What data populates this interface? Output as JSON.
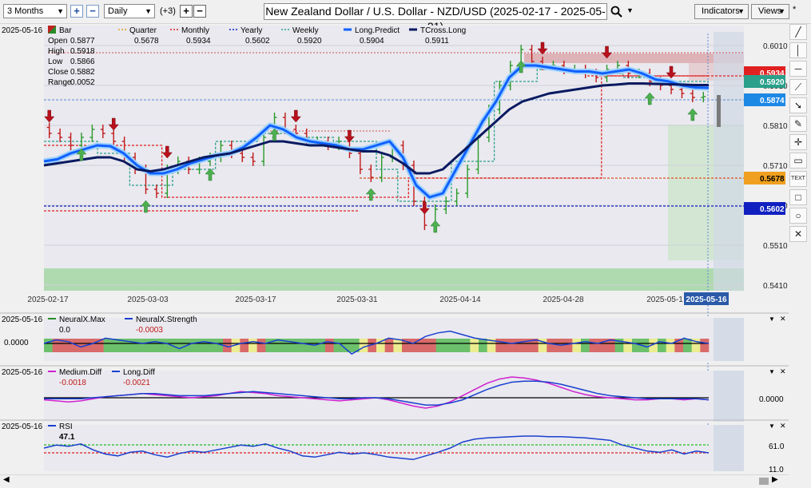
{
  "toolbar": {
    "period": "3 Months",
    "interval": "Daily",
    "extra": "(+3)",
    "title": "New Zealand Dollar / U.S. Dollar - NZD/USD (2025-02-17 - 2025-05-21)",
    "indicators_label": "Indicators",
    "views_label": "Views",
    "pin": "*"
  },
  "main_panel": {
    "date": "2025-05-16",
    "ohlc": [
      {
        "label": "Open",
        "value": "0.5877"
      },
      {
        "label": "High",
        "value": "0.5918"
      },
      {
        "label": "Low",
        "value": "0.5866"
      },
      {
        "label": "Close",
        "value": "0.5882"
      },
      {
        "label": "Range",
        "value": "0.0052"
      }
    ],
    "legend": [
      {
        "name": "Bar",
        "value": "",
        "color": "#2a8a2a"
      },
      {
        "name": "Quarter",
        "value": "0.5678",
        "color": "#e2a51e"
      },
      {
        "name": "Monthly",
        "value": "0.5934",
        "color": "#e02020"
      },
      {
        "name": "Yearly",
        "value": "0.5602",
        "color": "#1020c0"
      },
      {
        "name": "Weekly",
        "value": "0.5920",
        "color": "#2aa08a"
      },
      {
        "name": "Long.Predict",
        "value": "0.5904",
        "color": "#1060ff"
      },
      {
        "name": "TCross.Long",
        "value": "0.5911",
        "color": "#0a1a60"
      }
    ],
    "price_ticks": [
      "0.6010",
      "0.5910",
      "0.5810",
      "0.5710",
      "0.5610",
      "0.5510",
      "0.5410"
    ],
    "price_tags": [
      {
        "label": "0.5934",
        "color": "#e02020"
      },
      {
        "label": "0.5920",
        "color": "#2aa08a"
      },
      {
        "label": "0.5874",
        "color": "#1e88e5"
      },
      {
        "label": "0.5678",
        "color": "#f0a020"
      },
      {
        "label": "0.5602",
        "color": "#1020c0"
      }
    ],
    "date_ticks": [
      "2025-02-17",
      "2025-03-03",
      "2025-03-17",
      "2025-03-31",
      "2025-04-14",
      "2025-04-28",
      "2025-05-1",
      "2025-05-16"
    ]
  },
  "chart_data": {
    "type": "candlestick",
    "series": [
      {
        "name": "Long.Predict",
        "values": [
          0.572,
          0.5725,
          0.574,
          0.575,
          0.576,
          0.5758,
          0.574,
          0.571,
          0.569,
          0.569,
          0.57,
          0.5715,
          0.5725,
          0.5735,
          0.574,
          0.5755,
          0.578,
          0.581,
          0.58,
          0.578,
          0.577,
          0.5765,
          0.576,
          0.575,
          0.575,
          0.576,
          0.577,
          0.573,
          0.566,
          0.563,
          0.564,
          0.57,
          0.576,
          0.582,
          0.587,
          0.593,
          0.596,
          0.596,
          0.5955,
          0.595,
          0.5945,
          0.5945,
          0.594,
          0.5945,
          0.595,
          0.594,
          0.5925,
          0.592,
          0.591,
          0.5905,
          0.5904
        ]
      },
      {
        "name": "TCross.Long",
        "values": [
          0.571,
          0.5715,
          0.572,
          0.5725,
          0.573,
          0.573,
          0.572,
          0.57,
          0.5695,
          0.57,
          0.571,
          0.572,
          0.573,
          0.5735,
          0.574,
          0.575,
          0.576,
          0.577,
          0.577,
          0.5765,
          0.576,
          0.576,
          0.5755,
          0.575,
          0.5745,
          0.5745,
          0.5735,
          0.5715,
          0.569,
          0.569,
          0.57,
          0.573,
          0.576,
          0.579,
          0.582,
          0.585,
          0.587,
          0.588,
          0.589,
          0.5895,
          0.59,
          0.5905,
          0.591,
          0.5912,
          0.5915,
          0.5915,
          0.5914,
          0.5913,
          0.5912,
          0.5911,
          0.5911
        ]
      }
    ],
    "levels": {
      "quarter": 0.5678,
      "monthly": 0.5934,
      "yearly": 0.5602,
      "weekly": 0.592
    },
    "ylim": [
      0.54,
      0.606
    ]
  },
  "neuralx_panel": {
    "date": "2025-05-16",
    "legend": [
      {
        "name": "NeuralX.Max",
        "value": "0.0",
        "color": "#2a8a2a"
      },
      {
        "name": "NeuralX.Strength",
        "value": "-0.0003",
        "color": "#1a3fd0"
      }
    ],
    "tick": "0.0000"
  },
  "diff_panel": {
    "date": "2025-05-16",
    "legend": [
      {
        "name": "Medium.Diff",
        "value": "-0.0018",
        "color": "#d020d0"
      },
      {
        "name": "Long.Diff",
        "value": "-0.0021",
        "color": "#1a3fd0"
      }
    ],
    "tick": "0.0000"
  },
  "rsi_panel": {
    "date": "2025-05-16",
    "legend": [
      {
        "name": "RSI",
        "value": "47.1",
        "color": "#1a3fd0"
      }
    ],
    "ticks": [
      "61.0",
      "11.0"
    ]
  }
}
